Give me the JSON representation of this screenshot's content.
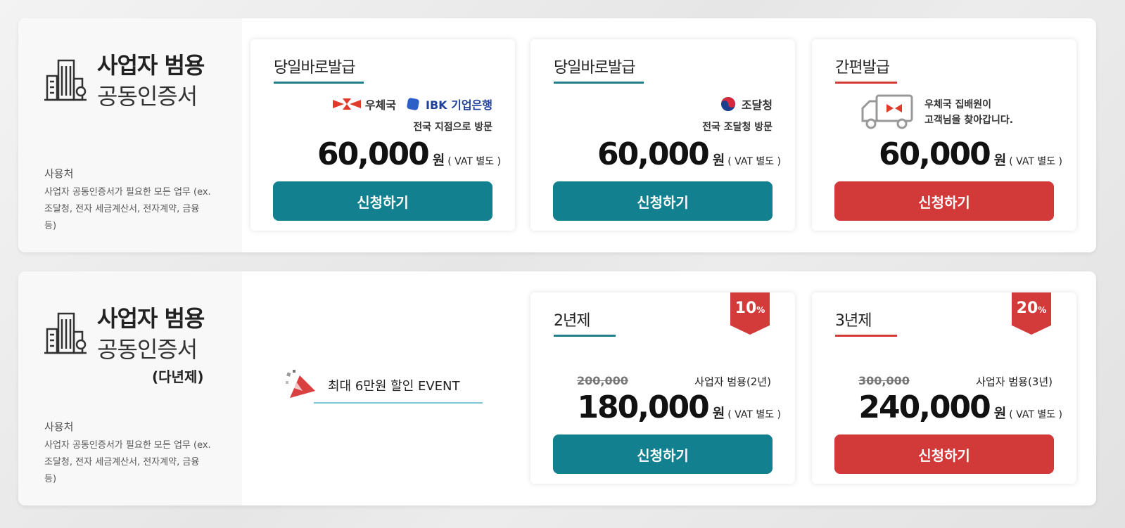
{
  "panel1": {
    "title_line1": "사업자 범용",
    "title_line2": "공동인증서",
    "usage_heading": "사용처",
    "usage_text": "사업자 공동인증서가 필요한 모든 업무 (ex.조달청, 전자 세금계산서, 전자계약, 금융 등)",
    "cards": [
      {
        "title": "당일바로발급",
        "logo1": "우체국",
        "logo2": "IBK 기업은행",
        "sub": "전국 지점으로 방문",
        "price": "60,000",
        "won": "원",
        "vat": "( VAT 별도 )",
        "button": "신청하기"
      },
      {
        "title": "당일바로발급",
        "logo1": "조달청",
        "sub": "전국 조달청 방문",
        "price": "60,000",
        "won": "원",
        "vat": "( VAT 별도 )",
        "button": "신청하기"
      },
      {
        "title": "간편발급",
        "msg_line1": "우체국 집배원이",
        "msg_line2": "고객님을 찾아갑니다.",
        "price": "60,000",
        "won": "원",
        "vat": "( VAT 별도 )",
        "button": "신청하기"
      }
    ]
  },
  "panel2": {
    "title_line1": "사업자 범용",
    "title_line2": "공동인증서",
    "title_line3": "(다년제)",
    "usage_heading": "사용처",
    "usage_text": "사업자 공동인증서가 필요한 모든 업무 (ex.조달청, 전자 세금계산서, 전자계약, 금융 등)",
    "event": "최대 6만원 할인 EVENT",
    "cards": [
      {
        "title": "2년제",
        "badge": "10",
        "badge_unit": "%",
        "original": "200,000",
        "desc": "사업자 범용(2년)",
        "price": "180,000",
        "won": "원",
        "vat": "( VAT 별도 )",
        "button": "신청하기"
      },
      {
        "title": "3년제",
        "badge": "20",
        "badge_unit": "%",
        "original": "300,000",
        "desc": "사업자 범용(3년)",
        "price": "240,000",
        "won": "원",
        "vat": "( VAT 별도 )",
        "button": "신청하기"
      }
    ]
  },
  "colors": {
    "teal": "#13808f",
    "red": "#d23a3a"
  }
}
